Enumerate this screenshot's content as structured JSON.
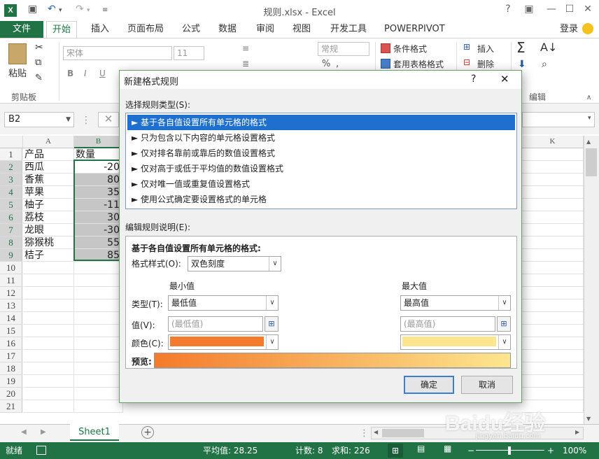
{
  "window": {
    "title": "规则.xlsx - Excel",
    "icon_text": "X",
    "login": "登录"
  },
  "ribbon": {
    "tabs": [
      "文件",
      "开始",
      "插入",
      "页面布局",
      "公式",
      "数据",
      "审阅",
      "视图",
      "开发工具",
      "POWERPIVOT"
    ],
    "paste": "粘贴",
    "clipboard_group": "剪贴板",
    "font_name": "宋体",
    "font_size": "11",
    "number_format": "常规",
    "cond_format": "条件格式",
    "table_format": "套用表格格式",
    "insert": "插入",
    "delete": "删除",
    "edit_group": "编辑",
    "bold": "B",
    "italic": "I",
    "underline": "U"
  },
  "formula": {
    "namebox": "B2"
  },
  "grid": {
    "columns": [
      "A",
      "B",
      "K"
    ],
    "rows": [
      "1",
      "2",
      "3",
      "4",
      "5",
      "6",
      "7",
      "8",
      "9",
      "10",
      "11",
      "12",
      "13",
      "14",
      "15",
      "16",
      "17",
      "18",
      "19",
      "20",
      "21"
    ],
    "colA": [
      "产品",
      "西瓜",
      "香蕉",
      "苹果",
      "柚子",
      "荔枝",
      "龙眼",
      "猕猴桃",
      "桔子"
    ],
    "colB": [
      "数量",
      "-20",
      "80",
      "35",
      "-11",
      "30",
      "-30",
      "55",
      "85"
    ]
  },
  "sheet": {
    "tab": "Sheet1"
  },
  "status": {
    "ready": "就绪",
    "average": "平均值: 28.25",
    "count": "计数: 8",
    "sum": "求和: 226",
    "zoom": "100%"
  },
  "dialog": {
    "title": "新建格式规则",
    "help": "?",
    "close": "✕",
    "rule_type_label": "选择规则类型(S):",
    "rule_types": [
      "► 基于各自值设置所有单元格的格式",
      "► 只为包含以下内容的单元格设置格式",
      "► 仅对排名靠前或靠后的数值设置格式",
      "► 仅对高于或低于平均值的数值设置格式",
      "► 仅对唯一值或重复值设置格式",
      "► 使用公式确定要设置格式的单元格"
    ],
    "edit_label": "编辑规则说明(E):",
    "desc_heading": "基于各自值设置所有单元格的格式:",
    "style_label": "格式样式(O):",
    "style_value": "双色刻度",
    "min_label": "最小值",
    "max_label": "最大值",
    "type_label": "类型(T):",
    "min_type": "最低值",
    "max_type": "最高值",
    "value_label": "值(V):",
    "min_value": "(最低值)",
    "max_value": "(最高值)",
    "color_label": "颜色(C):",
    "min_color": "#f47b2b",
    "max_color": "#fde68f",
    "preview_label": "预览:",
    "ok": "确定",
    "cancel": "取消"
  },
  "watermark": {
    "text": "Baidu经验",
    "url": "jingyan.baidu.com"
  }
}
